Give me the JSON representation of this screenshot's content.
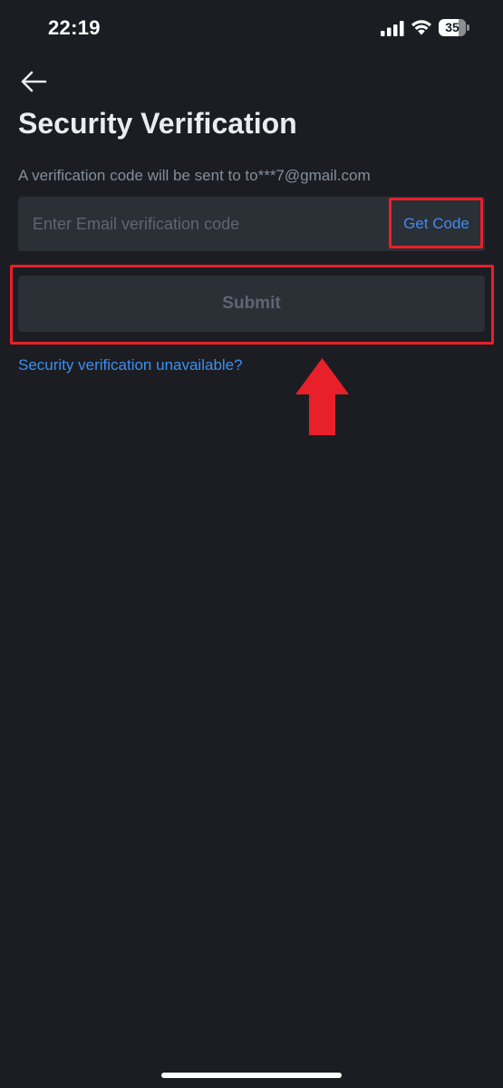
{
  "status_bar": {
    "time": "22:19",
    "battery_level": "35",
    "icons": [
      "signal-icon",
      "wifi-icon",
      "battery-icon"
    ]
  },
  "header": {
    "back_icon": "arrow-left-icon",
    "title": "Security Verification"
  },
  "form": {
    "subtitle": "A verification code will be sent to to***7@gmail.com",
    "code_input": {
      "placeholder": "Enter Email verification code",
      "value": ""
    },
    "get_code_label": "Get Code",
    "submit_label": "Submit",
    "unavailable_link": "Security verification unavailable?"
  },
  "annotations": {
    "highlight_color": "#e8202a",
    "arrow_icon": "red-up-arrow-icon"
  },
  "colors": {
    "background": "#1c1d22",
    "field": "#2b2f36",
    "link": "#3d8ef0",
    "muted_text": "#848e9c",
    "disabled_text": "#5e6673"
  }
}
